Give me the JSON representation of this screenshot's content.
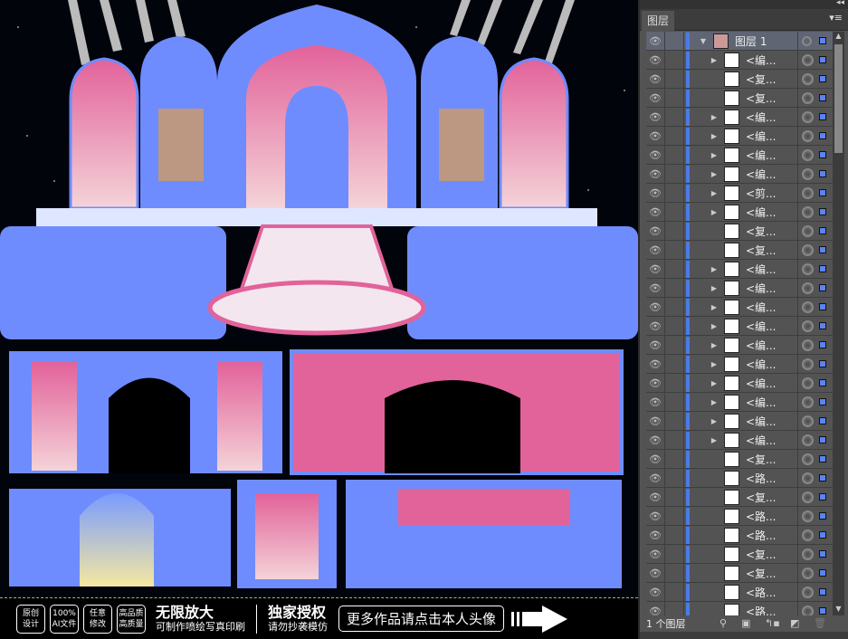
{
  "banner": {
    "badges": [
      "原创\n设计",
      "100%\nAI文件",
      "任意\n修改",
      "高品质\n高质量"
    ],
    "slogan1": "无限放大",
    "slogan1_sub": "可制作喷绘写真印刷",
    "slogan2": "独家授权",
    "slogan2_sub": "请勿抄袭模仿",
    "more": "更多作品请点击本人头像"
  },
  "panel": {
    "tab": "图层",
    "collapse_icon": "double-chevron-icon",
    "top_layer": "图层 1",
    "footer_count": "1 个图层",
    "selection_color": "#5c82f4",
    "layers": [
      {
        "label": "<编...",
        "expand": true
      },
      {
        "label": "<复...",
        "expand": false
      },
      {
        "label": "<复...",
        "expand": false
      },
      {
        "label": "<编...",
        "expand": true
      },
      {
        "label": "<编...",
        "expand": true
      },
      {
        "label": "<编...",
        "expand": true
      },
      {
        "label": "<编...",
        "expand": true
      },
      {
        "label": "<剪...",
        "expand": true
      },
      {
        "label": "<编...",
        "expand": true
      },
      {
        "label": "<复...",
        "expand": false
      },
      {
        "label": "<复...",
        "expand": false
      },
      {
        "label": "<编...",
        "expand": true
      },
      {
        "label": "<编...",
        "expand": true
      },
      {
        "label": "<编...",
        "expand": true
      },
      {
        "label": "<编...",
        "expand": true
      },
      {
        "label": "<编...",
        "expand": true
      },
      {
        "label": "<编...",
        "expand": true
      },
      {
        "label": "<编...",
        "expand": true
      },
      {
        "label": "<编...",
        "expand": true
      },
      {
        "label": "<编...",
        "expand": true
      },
      {
        "label": "<编...",
        "expand": true
      },
      {
        "label": "<复...",
        "expand": false
      },
      {
        "label": "<路...",
        "expand": false
      },
      {
        "label": "<复...",
        "expand": false
      },
      {
        "label": "<路...",
        "expand": false
      },
      {
        "label": "<路...",
        "expand": false
      },
      {
        "label": "<复...",
        "expand": false
      },
      {
        "label": "<复...",
        "expand": false
      },
      {
        "label": "<路...",
        "expand": false
      },
      {
        "label": "<路...",
        "expand": false
      }
    ]
  },
  "colors": {
    "artwork_blue": "#6f8cff",
    "artwork_pink": "#e2629a",
    "selection": "#5c82f4"
  }
}
